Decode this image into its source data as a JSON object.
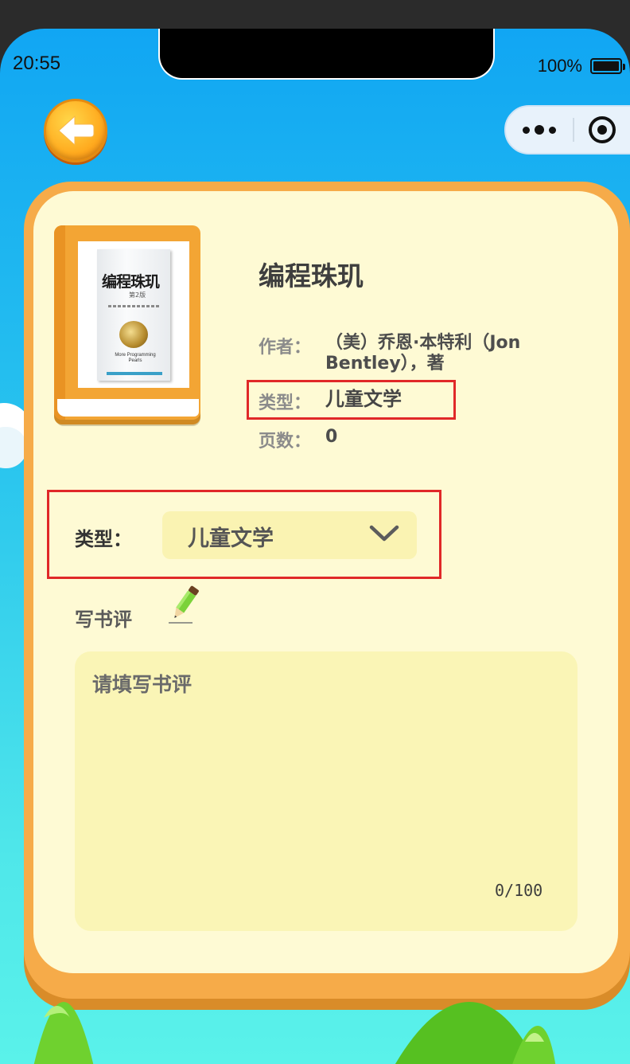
{
  "status_bar": {
    "time": "20:55",
    "battery": "100%"
  },
  "nav": {
    "back_icon": "back-arrow-icon",
    "menu_icon": "more-dots-icon",
    "close_icon": "target-close-icon"
  },
  "book": {
    "cover_icon": "book-cover-image",
    "cover_title": "编程珠玑",
    "cover_edition": "第2版",
    "cover_english": "More Programming Pearls",
    "title": "编程珠玑",
    "author_label": "作者：",
    "author_value": "（美）乔恩·本特利（Jon Bentley），著",
    "type_label": "类型：",
    "type_value": "儿童文学",
    "pages_label": "页数：",
    "pages_value": "0"
  },
  "form": {
    "type_label": "类型：",
    "type_selected": "儿童文学",
    "review_label": "写书评",
    "review_placeholder": "请填写书评",
    "review_counter": "0/100"
  },
  "colors": {
    "card_border": "#f6ab49",
    "card_bg": "#fefad4",
    "input_bg": "#faf5b6",
    "highlight": "#e02828"
  }
}
